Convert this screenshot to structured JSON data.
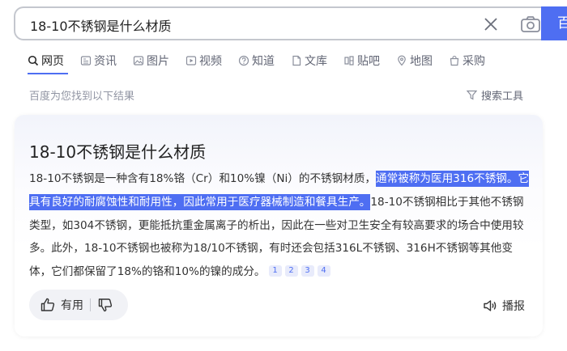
{
  "search": {
    "query": "18-10不锈钢是什么材质",
    "button_label": "百度一下"
  },
  "tabs": [
    {
      "label": "网页",
      "icon": "search-icon"
    },
    {
      "label": "资讯",
      "icon": "news-icon"
    },
    {
      "label": "图片",
      "icon": "image-icon"
    },
    {
      "label": "视频",
      "icon": "video-icon"
    },
    {
      "label": "知道",
      "icon": "question-icon"
    },
    {
      "label": "文库",
      "icon": "document-icon"
    },
    {
      "label": "贴吧",
      "icon": "forum-icon"
    },
    {
      "label": "地图",
      "icon": "map-icon"
    },
    {
      "label": "采购",
      "icon": "shopping-icon"
    }
  ],
  "result_count": "百度为您找到以下结果",
  "tools_label": "搜索工具",
  "answer": {
    "title": "18-10不锈钢是什么材质",
    "text_1": "18-10不锈钢是一种含有18%铬（Cr）和10%镍（Ni）的不锈钢材质，",
    "text_highlight": "通常被称为医用316不锈钢。它具有良好的耐腐蚀性和耐用性，因此常用于医疗器械制造和餐具生产。",
    "text_2": "18-10不锈钢相比于其他不锈钢类型，如304不锈钢，更能抵抗重金属离子的析出，因此在一些对卫生安全有较高要求的场合中使用较多。此外，18-10不锈钢也被称为18/10不锈钢，有时还会包括316L不锈钢、316H不锈钢等其他变体，它们都保留了18%的铬和10%的镍的成分。",
    "refs": [
      "1",
      "2",
      "3",
      "4"
    ],
    "useful_label": "有用",
    "broadcast_label": "播报"
  },
  "colors": {
    "accent": "#4e6ef2",
    "highlight_bg": "#4e6ef2"
  }
}
